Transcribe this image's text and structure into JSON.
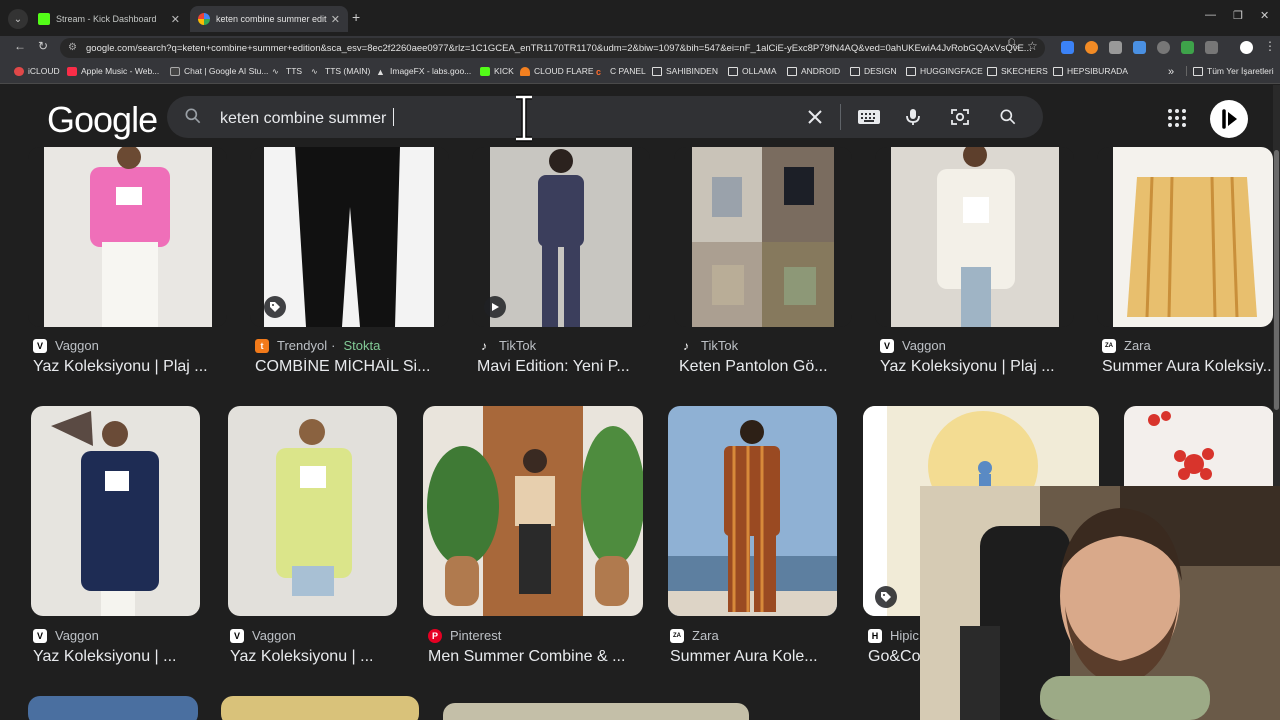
{
  "browser": {
    "tabs": [
      {
        "title": "Stream - Kick Dashboard",
        "active": false,
        "favicon": "kick-icon"
      },
      {
        "title": "keten combine summer edition",
        "active": true,
        "favicon": "google-icon"
      }
    ],
    "url": "google.com/search?q=keten+combine+summer+edition&sca_esv=8ec2f2260aee0977&rlz=1C1GCEA_enTR1170TR1170&udm=2&biw=1097&bih=547&ei=nF_1alCiE-yExc8P79fN4AQ&ved=0ahUKEwiA4JvRobGQAxVsQvE...",
    "bookmarks": [
      {
        "label": "iCLOUD",
        "color": "#e04848"
      },
      {
        "label": "Apple Music - Web...",
        "color": "#fa2d48"
      },
      {
        "label": "Chat | Google AI Stu...",
        "color": "#444444"
      },
      {
        "label": "TTS",
        "color": "#ffffff"
      },
      {
        "label": "TTS (MAIN)",
        "color": "#ffffff"
      },
      {
        "label": "ImageFX - labs.goo...",
        "color": "#ffffff"
      },
      {
        "label": "KICK",
        "color": "#53fc18"
      },
      {
        "label": "CLOUD FLARE",
        "color": "#f38020"
      },
      {
        "label": "C PANEL",
        "color": "#ff6c2c"
      },
      {
        "label": "SAHIBINDEN",
        "color": "folder"
      },
      {
        "label": "OLLAMA",
        "color": "folder"
      },
      {
        "label": "ANDROID",
        "color": "folder"
      },
      {
        "label": "DESIGN",
        "color": "folder"
      },
      {
        "label": "HUGGINGFACE",
        "color": "folder"
      },
      {
        "label": "SKECHERS",
        "color": "folder"
      },
      {
        "label": "HEPSIBURADA",
        "color": "folder"
      }
    ],
    "bookmarks_overflow": "»",
    "all_bookmarks": "Tüm Yer İşaretleri"
  },
  "google": {
    "logo": "Google",
    "query": "keten combine summer "
  },
  "results": {
    "row1": [
      {
        "source": "Vaggon",
        "title": "Yaz Koleksiyonu | Plaj ...",
        "icon": "vaggon-icon",
        "bg": "#e8e6e1",
        "fg": "#ee5fb4"
      },
      {
        "source": "Trendyol",
        "stock": "Stokta",
        "title": "COMBİNE MİCHAİL Si...",
        "icon": "trendyol-icon",
        "bg": "#f2f2f2",
        "fg": "#111111"
      },
      {
        "source": "TikTok",
        "title": "Mavi Edition: Yeni P...",
        "icon": "tiktok-icon",
        "bg": "#c9c7c2",
        "fg": "#3a3d5a"
      },
      {
        "source": "TikTok",
        "title": "Keten Pantolon Gö...",
        "icon": "tiktok-icon",
        "bg": "#a9a095",
        "fg": "#e8e2d2"
      },
      {
        "source": "Vaggon",
        "title": "Yaz Koleksiyonu | Plaj ...",
        "icon": "vaggon-icon",
        "bg": "#ddd9d2",
        "fg": "#f1eee6"
      },
      {
        "source": "Zara",
        "title": "Summer Aura Koleksiy...",
        "icon": "zara-icon",
        "bg": "#f3f1ec",
        "fg": "#e4b765"
      }
    ],
    "row2": [
      {
        "source": "Vaggon",
        "title": "Yaz Koleksiyonu | ...",
        "icon": "vaggon-icon",
        "bg": "#e7e5e0",
        "fg": "#1e2c54"
      },
      {
        "source": "Vaggon",
        "title": "Yaz Koleksiyonu | ...",
        "icon": "vaggon-icon",
        "bg": "#e2e0db",
        "fg": "#d8e283"
      },
      {
        "source": "Pinterest",
        "title": "Men Summer Combine & ...",
        "icon": "pinterest-icon",
        "bg": "#c08a5b",
        "fg": "#2f6a2c"
      },
      {
        "source": "Zara",
        "title": "Summer Aura Kole...",
        "icon": "zara-icon",
        "bg": "#7ea3c9",
        "fg": "#8a3f1c"
      },
      {
        "source": "Hipic",
        "title": "Go&Co",
        "icon": "hipicon-icon",
        "bg": "#f2ecd8",
        "fg": "#e2c976"
      },
      {
        "source": "",
        "title": "",
        "icon": "",
        "bg": "#f4f1ee",
        "fg": "#d8342c"
      }
    ]
  }
}
